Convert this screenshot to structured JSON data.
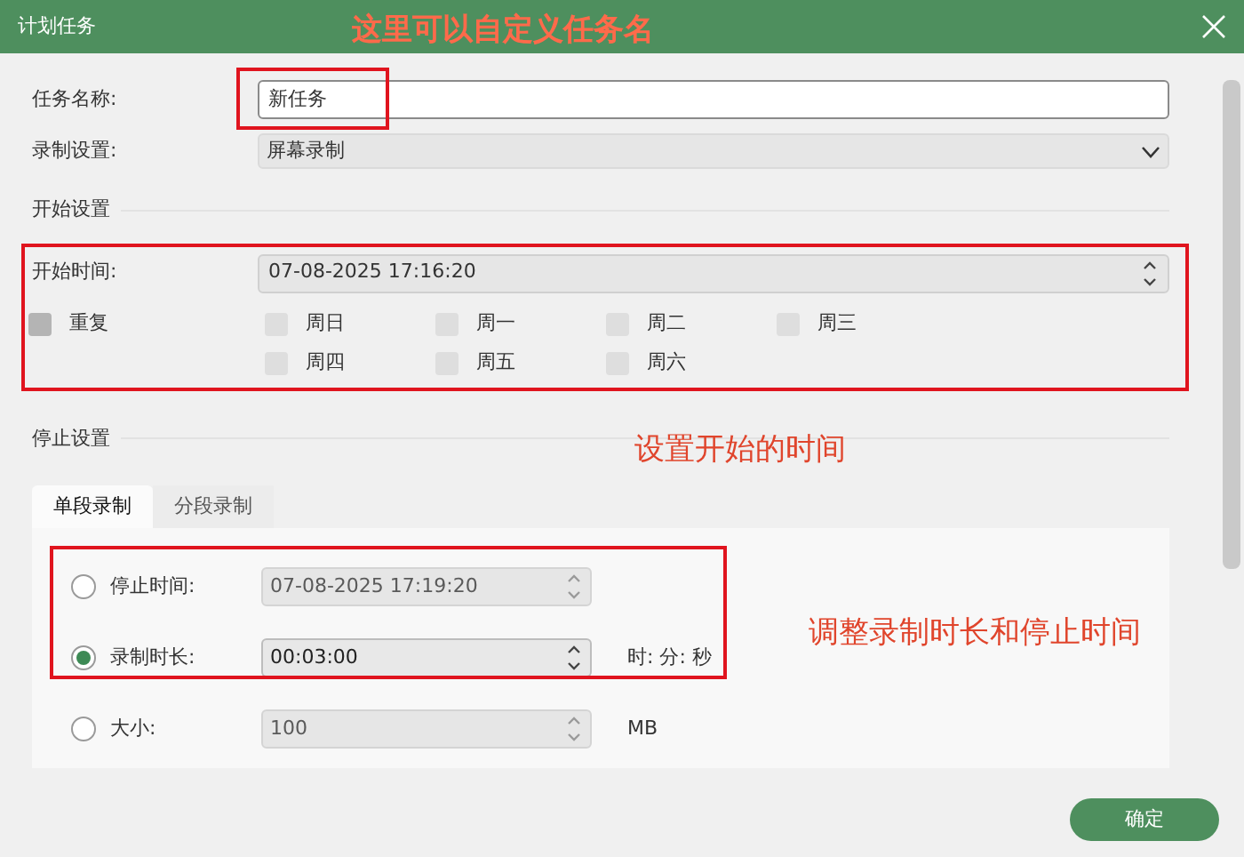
{
  "window": {
    "title": "计划任务"
  },
  "task_name": {
    "label": "任务名称:",
    "value": "新任务"
  },
  "record_setting": {
    "label": "录制设置:",
    "value": "屏幕录制"
  },
  "start_section": {
    "title": "开始设置",
    "time_label": "开始时间:",
    "time_value": "07-08-2025 17:16:20",
    "repeat": {
      "label": "重复",
      "checked": false
    },
    "days": [
      {
        "label": "周日",
        "checked": false
      },
      {
        "label": "周一",
        "checked": false
      },
      {
        "label": "周二",
        "checked": false
      },
      {
        "label": "周三",
        "checked": false
      },
      {
        "label": "周四",
        "checked": false
      },
      {
        "label": "周五",
        "checked": false
      },
      {
        "label": "周六",
        "checked": false
      }
    ]
  },
  "stop_section": {
    "title": "停止设置",
    "tabs": [
      {
        "label": "单段录制",
        "selected": true
      },
      {
        "label": "分段录制",
        "selected": false
      }
    ],
    "options": [
      {
        "label": "停止时间:",
        "value": "07-08-2025 17:19:20",
        "selected": false
      },
      {
        "label": "录制时长:",
        "value": "00:03:00",
        "selected": true,
        "unit": "时: 分: 秒"
      },
      {
        "label": "大小:",
        "value": "100",
        "selected": false,
        "unit": "MB"
      }
    ]
  },
  "footer": {
    "ok_button": "确定"
  },
  "annotations": [
    {
      "text": "这里可以自定义任务名"
    },
    {
      "text": "设置开始的时间"
    },
    {
      "text": "调整录制时长和停止时间"
    }
  ]
}
